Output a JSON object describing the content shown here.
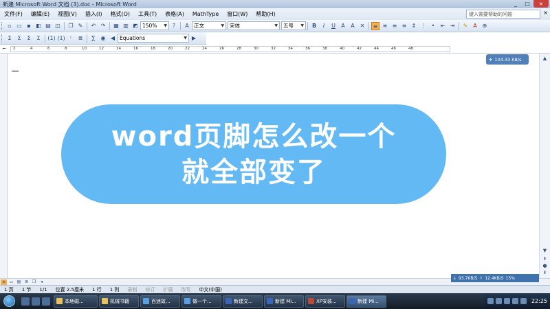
{
  "window": {
    "title": "新建 Microsoft Word 文档 (3).doc - Microsoft Word",
    "controls": [
      "_",
      "□",
      "×"
    ]
  },
  "menu": {
    "items": [
      "文件(F)",
      "编辑(E)",
      "视图(V)",
      "插入(I)",
      "格式(O)",
      "工具(T)",
      "表格(A)",
      "MathType",
      "窗口(W)",
      "帮助(H)"
    ],
    "ask_placeholder": "键入需要帮助的问题",
    "close": "×"
  },
  "toolbar": {
    "zoom": "150%",
    "style": "正文",
    "font": "宋体",
    "size": "五号",
    "bold": "B",
    "italic": "I",
    "underline": "U",
    "math_style": "Equations"
  },
  "ruler": {
    "ticks": [
      "2",
      "4",
      "6",
      "8",
      "10",
      "12",
      "14",
      "16",
      "18",
      "20",
      "22",
      "24",
      "26",
      "28",
      "30",
      "32",
      "34",
      "36",
      "38",
      "40",
      "42",
      "44",
      "46",
      "48"
    ]
  },
  "overlay": {
    "speed": "104.33 KB/s",
    "banner_line1": "word页脚怎么改一个",
    "banner_line2": "就全部变了"
  },
  "netmeter": {
    "down": "93.7KB/S",
    "up": "12.4KB/S",
    "percent": "15%"
  },
  "status": {
    "page": "1 页",
    "section": "1 节",
    "page_of": "1/1",
    "position": "位置 2.5厘米",
    "line": "1 行",
    "column": "1 列",
    "rec": "录制",
    "trk": "修订",
    "ext": "扩展",
    "ovr": "改写",
    "language": "中文(中国)"
  },
  "taskbar": {
    "tasks": [
      "本地磁...",
      "机械书籍",
      "百迷故...",
      "做一个...",
      "新建文...",
      "新建 Mi...",
      "XP安装...",
      "新建 Mi..."
    ],
    "clock": "22:25"
  }
}
